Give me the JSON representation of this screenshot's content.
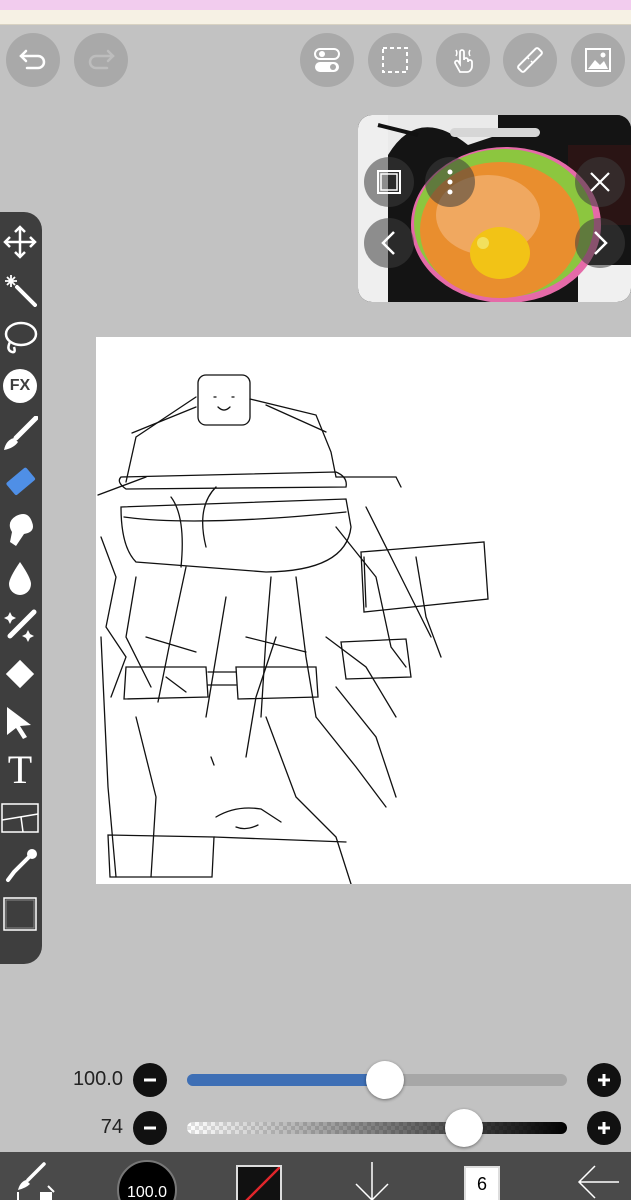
{
  "header": {
    "top_buttons": [
      {
        "name": "undo-icon"
      },
      {
        "name": "redo-icon"
      },
      {
        "name": "toggle-icon"
      },
      {
        "name": "selection-icon"
      },
      {
        "name": "gesture-icon"
      },
      {
        "name": "ruler-icon"
      },
      {
        "name": "material-icon"
      }
    ]
  },
  "toolbar": {
    "fx_label": "FX",
    "text_label": "T",
    "tools": [
      "move",
      "magic-wand",
      "lasso",
      "filter",
      "brush",
      "eraser",
      "smudge",
      "blur",
      "special-brush",
      "fill",
      "select",
      "text",
      "frame-divider",
      "eyedropper",
      "canvas"
    ]
  },
  "sliders": {
    "size": {
      "label": "100.0",
      "level": 0.52,
      "color": "#3e6fb5"
    },
    "opacity": {
      "label": "74",
      "level": 0.73
    }
  },
  "bottom": {
    "brush_size_label": "100.0",
    "layer_count": "6"
  },
  "colors": {
    "background": "#c2c2c2",
    "toolbar": "#3e3e3e",
    "active_tool": "#4f8fe6",
    "slider_accent": "#3e6fb5"
  }
}
